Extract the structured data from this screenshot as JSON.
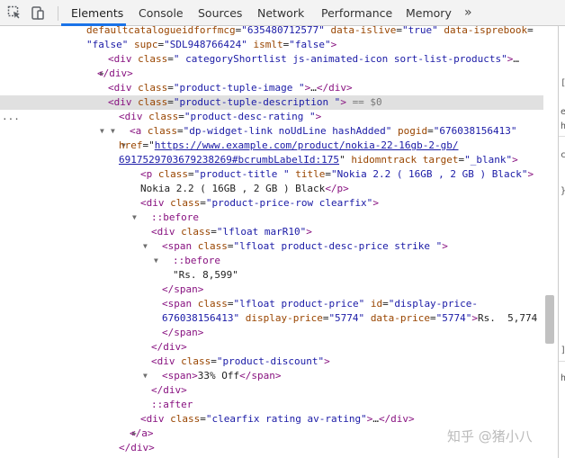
{
  "tabs": [
    {
      "label": "Elements",
      "active": true
    },
    {
      "label": "Console"
    },
    {
      "label": "Sources"
    },
    {
      "label": "Network"
    },
    {
      "label": "Performance"
    },
    {
      "label": "Memory"
    }
  ],
  "more_tabs": "»",
  "icons": {
    "inspect": "inspect-element-icon",
    "device": "device-toolbar-icon"
  },
  "code": {
    "l0": {
      "a1": "defaultcatalogueidforfmcg",
      "v1": "\"635480712577\"",
      "a2": "data-islive",
      "v2": "\"true\"",
      "a3": "data-isprebook"
    },
    "l1": {
      "v0": "\"false\"",
      "a1": "supc",
      "v1": "\"SDL948766424\"",
      "a2": "ismlt",
      "v2": "\"false\""
    },
    "l2": {
      "tag": "div",
      "attr": "class",
      "val": "\" categoryShortlist js-animated-icon sort-list-products\"",
      "ell": "…"
    },
    "l3": {
      "close": "</div>"
    },
    "l4": {
      "tag": "div",
      "attr": "class",
      "val": "\"product-tuple-image \"",
      "ell": "…",
      "close": "</div>"
    },
    "l5": {
      "dots": "...",
      "tag": "div",
      "attr": "class",
      "val": "\"product-tuple-description \"",
      "marker": "== $0"
    },
    "l6": {
      "tag": "div",
      "attr": "class",
      "val": "\"product-desc-rating \""
    },
    "l7": {
      "tag": "a",
      "attr1": "class",
      "val1": "\"dp-widget-link noUdLine hashAdded\"",
      "attr2": "pogid",
      "val2": "\"676038156413\""
    },
    "l8": {
      "attr": "href",
      "link": "https://www.example.com/product/nokia-22-16gb-2-gb/"
    },
    "l9": {
      "link": "691752970367923826",
      "link2": "9#bcrumbLabelId:175",
      "attr": "hidomntrack",
      "attr2": "target",
      "val2": "\"_blank\""
    },
    "l10": {
      "tag": "p",
      "attr1": "class",
      "val1": "\"product-title \"",
      "attr2": "title",
      "val2": "\"Nokia 2.2 ( 16GB , 2 GB ) Black\""
    },
    "l11": {
      "text": "Nokia 2.2 ( 16GB , 2 GB ) Black",
      "close": "</p>"
    },
    "l12": {
      "tag": "div",
      "attr": "class",
      "val": "\"product-price-row clearfix\""
    },
    "l13": {
      "pseudo": "::before"
    },
    "l14": {
      "tag": "div",
      "attr": "class",
      "val": "\"lfloat marR10\""
    },
    "l15": {
      "tag": "span",
      "attr": "class",
      "val": "\"lfloat product-desc-price strike \""
    },
    "l16": {
      "pseudo": "::before"
    },
    "l17": {
      "text": "\"Rs. 8,599\""
    },
    "l18": {
      "close": "</span>"
    },
    "l19": {
      "tag": "span",
      "attr1": "class",
      "val1": "\"lfloat product-price\"",
      "attr2": "id",
      "val2": "\"display-price-"
    },
    "l20": {
      "val0": "676038156413\"",
      "attr1": "display-price",
      "val1": "\"5774\"",
      "attr2": "data-price",
      "val2": "\"5774\"",
      "text": "Rs.  5,774"
    },
    "l21": {
      "close": "</span>"
    },
    "l22": {
      "close": "</div>"
    },
    "l23": {
      "tag": "div",
      "attr": "class",
      "val": "\"product-discount\""
    },
    "l24": {
      "open": "<span>",
      "text": "33% Off",
      "close": "</span>"
    },
    "l25": {
      "close": "</div>"
    },
    "l26": {
      "pseudo": "::after"
    },
    "l27": {
      "tag": "div",
      "attr": "class",
      "val": "\"clearfix rating av-rating\"",
      "ell": "…",
      "close": "</div>"
    },
    "l28": {
      "close": "</a>"
    },
    "l29": {
      "close": "</div>"
    }
  },
  "side": {
    "c1": "[",
    "c2": "e",
    "c3": "h",
    "c4": "c",
    "c5": "}",
    "c6": "]",
    "c7": "h"
  },
  "watermark": "知乎 @猪小八"
}
